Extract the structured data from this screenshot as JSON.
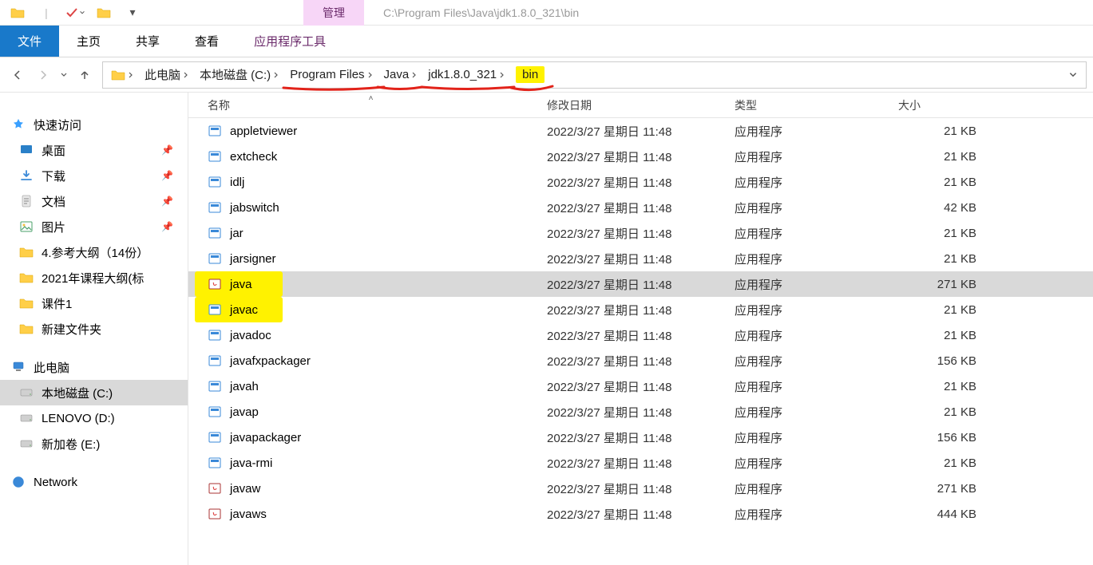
{
  "titlebar": {
    "manage_tab": "管理",
    "path_display": "C:\\Program Files\\Java\\jdk1.8.0_321\\bin"
  },
  "ribbon": {
    "file": "文件",
    "home": "主页",
    "share": "共享",
    "view": "查看",
    "app_tools": "应用程序工具"
  },
  "breadcrumb": {
    "this_pc": "此电脑",
    "local_disk": "本地磁盘 (C:)",
    "program_files": "Program Files",
    "java": "Java",
    "jdk": "jdk1.8.0_321",
    "bin": "bin"
  },
  "columns": {
    "name": "名称",
    "date": "修改日期",
    "type": "类型",
    "size": "大小"
  },
  "sidebar": {
    "quick_access": "快速访问",
    "desktop": "桌面",
    "downloads": "下载",
    "documents": "文档",
    "pictures": "图片",
    "folder_ref": "4.参考大纲（14份）",
    "folder_2021": "2021年课程大纲(标",
    "folder_kj": "课件1",
    "folder_new": "新建文件夹",
    "this_pc": "此电脑",
    "local_disk_c": "本地磁盘 (C:)",
    "lenovo_d": "LENOVO (D:)",
    "new_vol_e": "新加卷 (E:)",
    "network": "Network"
  },
  "files": [
    {
      "name": "appletviewer",
      "date": "2022/3/27 星期日 11:48",
      "type": "应用程序",
      "size": "21 KB",
      "icon": "exe",
      "selected": false,
      "hl": false
    },
    {
      "name": "extcheck",
      "date": "2022/3/27 星期日 11:48",
      "type": "应用程序",
      "size": "21 KB",
      "icon": "exe",
      "selected": false,
      "hl": false
    },
    {
      "name": "idlj",
      "date": "2022/3/27 星期日 11:48",
      "type": "应用程序",
      "size": "21 KB",
      "icon": "exe",
      "selected": false,
      "hl": false
    },
    {
      "name": "jabswitch",
      "date": "2022/3/27 星期日 11:48",
      "type": "应用程序",
      "size": "42 KB",
      "icon": "exe",
      "selected": false,
      "hl": false
    },
    {
      "name": "jar",
      "date": "2022/3/27 星期日 11:48",
      "type": "应用程序",
      "size": "21 KB",
      "icon": "exe",
      "selected": false,
      "hl": false
    },
    {
      "name": "jarsigner",
      "date": "2022/3/27 星期日 11:48",
      "type": "应用程序",
      "size": "21 KB",
      "icon": "exe",
      "selected": false,
      "hl": false
    },
    {
      "name": "java",
      "date": "2022/3/27 星期日 11:48",
      "type": "应用程序",
      "size": "271 KB",
      "icon": "java",
      "selected": true,
      "hl": true
    },
    {
      "name": "javac",
      "date": "2022/3/27 星期日 11:48",
      "type": "应用程序",
      "size": "21 KB",
      "icon": "exe",
      "selected": false,
      "hl": true
    },
    {
      "name": "javadoc",
      "date": "2022/3/27 星期日 11:48",
      "type": "应用程序",
      "size": "21 KB",
      "icon": "exe",
      "selected": false,
      "hl": false
    },
    {
      "name": "javafxpackager",
      "date": "2022/3/27 星期日 11:48",
      "type": "应用程序",
      "size": "156 KB",
      "icon": "exe",
      "selected": false,
      "hl": false
    },
    {
      "name": "javah",
      "date": "2022/3/27 星期日 11:48",
      "type": "应用程序",
      "size": "21 KB",
      "icon": "exe",
      "selected": false,
      "hl": false
    },
    {
      "name": "javap",
      "date": "2022/3/27 星期日 11:48",
      "type": "应用程序",
      "size": "21 KB",
      "icon": "exe",
      "selected": false,
      "hl": false
    },
    {
      "name": "javapackager",
      "date": "2022/3/27 星期日 11:48",
      "type": "应用程序",
      "size": "156 KB",
      "icon": "exe",
      "selected": false,
      "hl": false
    },
    {
      "name": "java-rmi",
      "date": "2022/3/27 星期日 11:48",
      "type": "应用程序",
      "size": "21 KB",
      "icon": "exe",
      "selected": false,
      "hl": false
    },
    {
      "name": "javaw",
      "date": "2022/3/27 星期日 11:48",
      "type": "应用程序",
      "size": "271 KB",
      "icon": "java",
      "selected": false,
      "hl": false
    },
    {
      "name": "javaws",
      "date": "2022/3/27 星期日 11:48",
      "type": "应用程序",
      "size": "444 KB",
      "icon": "java",
      "selected": false,
      "hl": false
    }
  ]
}
